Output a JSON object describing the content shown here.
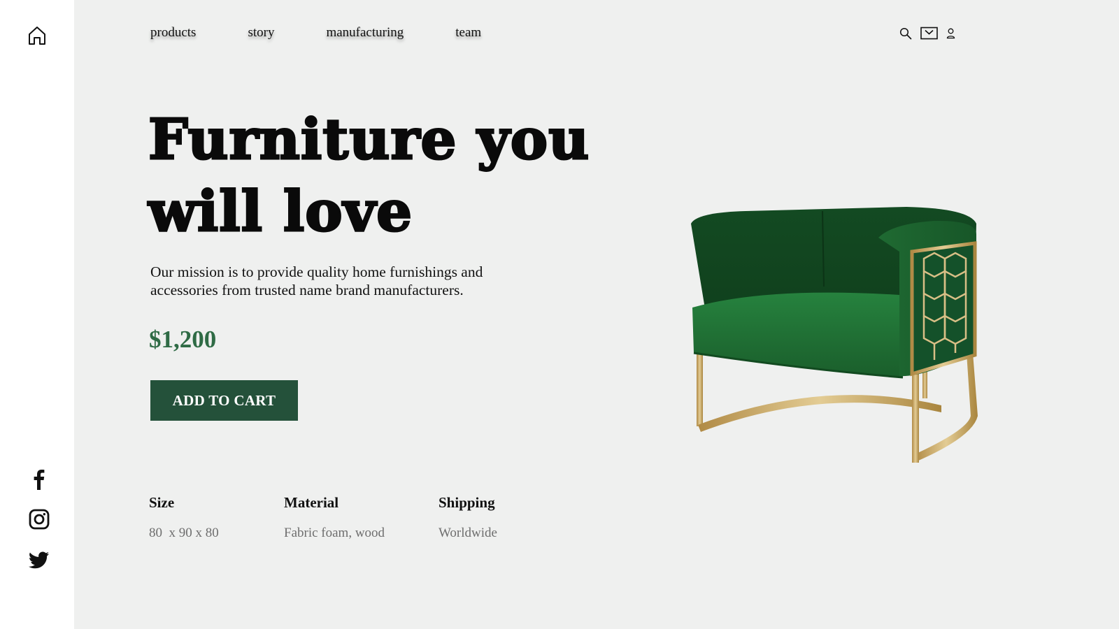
{
  "nav": {
    "links": [
      "products",
      "story",
      "manufacturing",
      "team"
    ]
  },
  "icons": {
    "sidebar_top": "home-icon",
    "social": [
      "facebook-icon",
      "instagram-icon",
      "twitter-icon"
    ],
    "header": [
      "search-icon",
      "cart-icon",
      "user-icon"
    ]
  },
  "hero": {
    "headline_line1": "Furniture you",
    "headline_line2": "will love",
    "mission": "Our mission is to provide quality home furnishings and accessories from trusted name brand manufacturers.",
    "price": "$1,200",
    "cta_label": "ADD TO CART"
  },
  "specs": {
    "size_label": "Size",
    "size_value": "80  x 90 x 80",
    "material_label": "Material",
    "material_value": "Fabric foam, wood",
    "shipping_label": "Shipping",
    "shipping_value": "Worldwide"
  },
  "colors": {
    "main_bg": "#eff0ef",
    "sidebar_bg": "#ffffff",
    "accent": "#2f6b45",
    "button_bg": "#24513a",
    "chair_green": "#1f6a32",
    "chair_gold": "#c9a865"
  }
}
